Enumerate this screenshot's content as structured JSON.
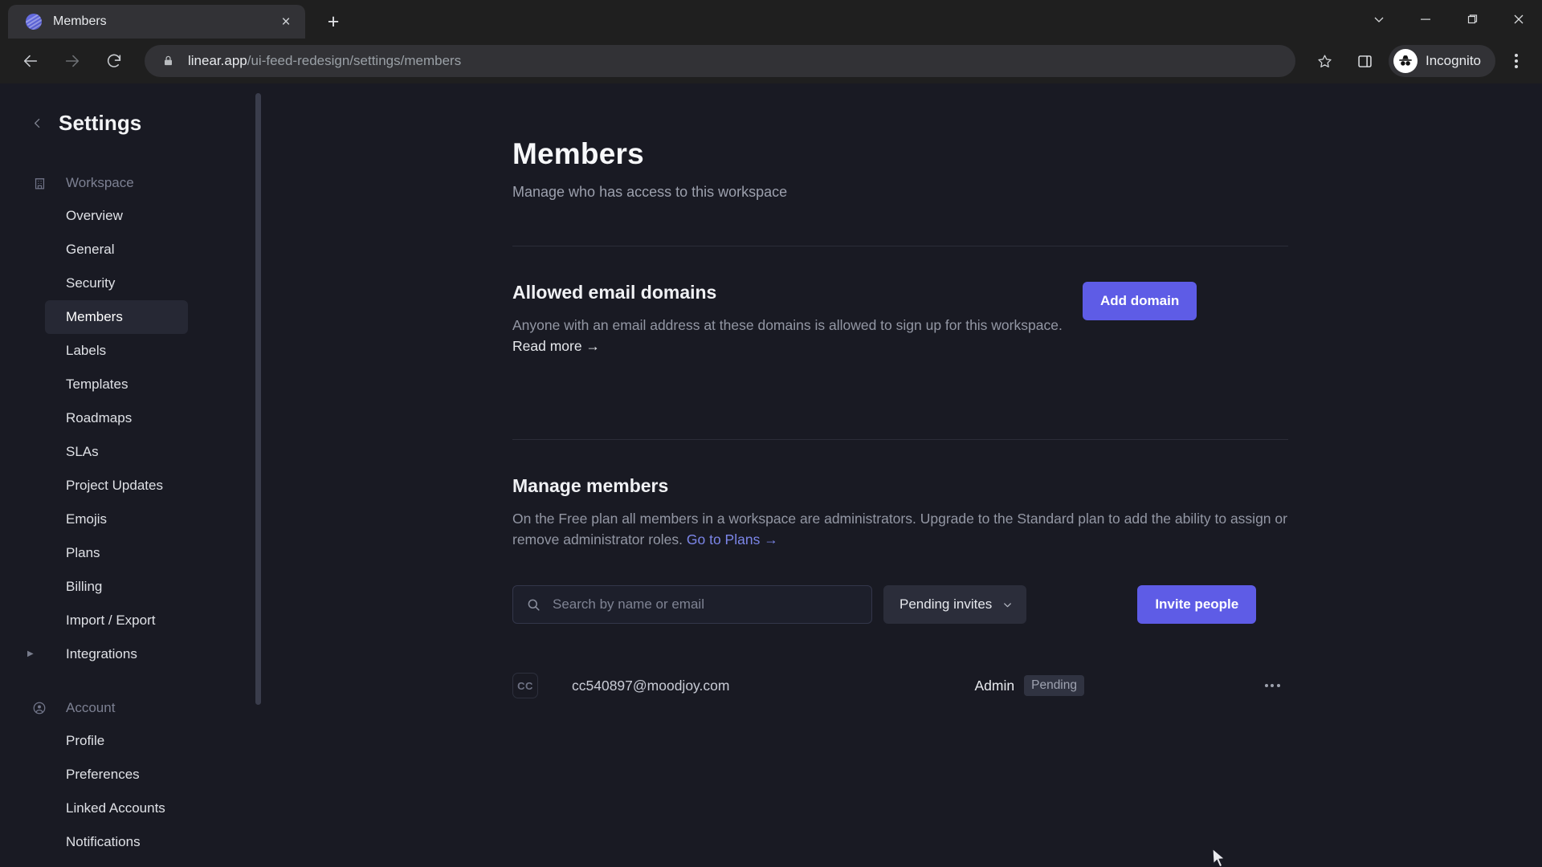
{
  "browser": {
    "tab": {
      "title": "Members",
      "favicon": "linear-logo-icon",
      "close": "×"
    },
    "new_tab_label": "+",
    "window_controls": [
      "chevron-down-icon",
      "minimize-icon",
      "maximize-icon",
      "close-icon"
    ],
    "nav": {
      "back": "back-arrow-icon",
      "forward": "forward-arrow-icon",
      "reload": "reload-icon"
    },
    "address": {
      "lock": "lock-icon",
      "domain": "linear.app",
      "path": "/ui-feed-redesign/settings/members"
    },
    "bookmark": "star-icon",
    "side_panel": "side-panel-icon",
    "profile": {
      "label": "Incognito",
      "icon": "incognito-icon"
    },
    "menu": "kebab-menu-icon"
  },
  "sidebar": {
    "back_icon": "chevron-left-icon",
    "title": "Settings",
    "groups": [
      {
        "icon": "building-icon",
        "label": "Workspace",
        "items": [
          {
            "label": "Overview",
            "active": false
          },
          {
            "label": "General",
            "active": false
          },
          {
            "label": "Security",
            "active": false
          },
          {
            "label": "Members",
            "active": true
          },
          {
            "label": "Labels",
            "active": false
          },
          {
            "label": "Templates",
            "active": false
          },
          {
            "label": "Roadmaps",
            "active": false
          },
          {
            "label": "SLAs",
            "active": false
          },
          {
            "label": "Project Updates",
            "active": false
          },
          {
            "label": "Emojis",
            "active": false
          },
          {
            "label": "Plans",
            "active": false
          },
          {
            "label": "Billing",
            "active": false
          },
          {
            "label": "Import / Export",
            "active": false
          },
          {
            "label": "Integrations",
            "active": false,
            "expandable": true
          }
        ]
      },
      {
        "icon": "account-circle-icon",
        "label": "Account",
        "items": [
          {
            "label": "Profile",
            "active": false
          },
          {
            "label": "Preferences",
            "active": false
          },
          {
            "label": "Linked Accounts",
            "active": false
          },
          {
            "label": "Notifications",
            "active": false
          }
        ]
      }
    ]
  },
  "main": {
    "title": "Members",
    "subtitle": "Manage who has access to this workspace",
    "domains_section": {
      "title": "Allowed email domains",
      "desc_part1": "Anyone with an email address at these domains is allowed to sign up for this workspace. ",
      "read_more": "Read more →",
      "button": "Add domain"
    },
    "manage_section": {
      "title": "Manage members",
      "desc_part1": "On the Free plan all members in a workspace are administrators. Upgrade to the Standard plan to add the ability to assign or remove administrator roles. ",
      "plans_link": "Go to Plans →"
    },
    "controls": {
      "search_placeholder": "Search by name or email",
      "search_value": "",
      "search_icon": "search-icon",
      "filter_label": "Pending invites",
      "filter_chevron": "chevron-down-icon",
      "invite_button": "Invite people"
    },
    "members_table": {
      "rows": [
        {
          "avatar_initials": "CC",
          "email": "cc540897@moodjoy.com",
          "role": "Admin",
          "status": "Pending",
          "menu": "more-options-icon"
        }
      ]
    }
  },
  "colors": {
    "accent": "#5e5ce6",
    "link": "#7c86e8",
    "app_bg": "#191a23",
    "sidebar_active": "#262834"
  }
}
